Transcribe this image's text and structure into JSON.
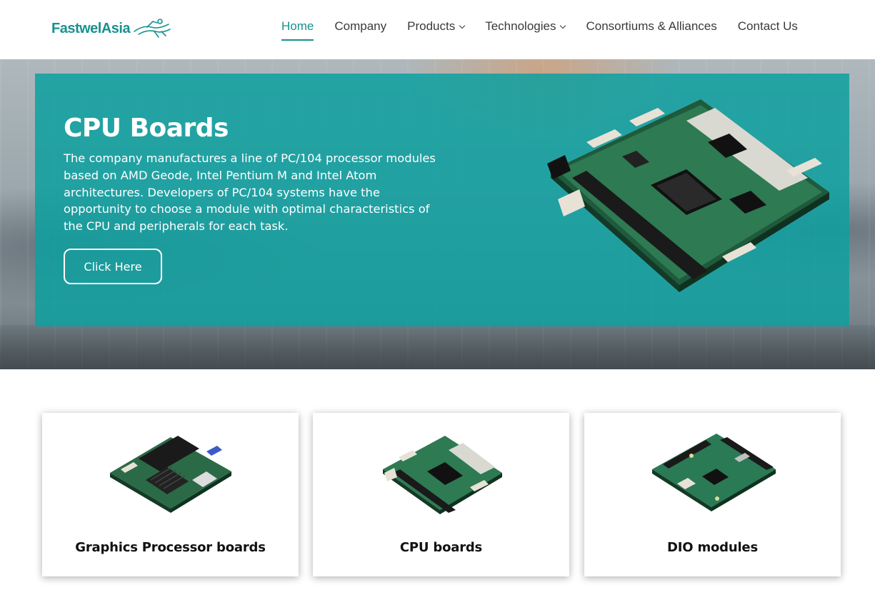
{
  "brand": {
    "name": "FastwelAsia",
    "color": "#17918f",
    "logo_icon": "flying-figure-logo"
  },
  "nav": {
    "items": [
      {
        "label": "Home",
        "active": true,
        "dropdown": false
      },
      {
        "label": "Company",
        "active": false,
        "dropdown": false
      },
      {
        "label": "Products",
        "active": false,
        "dropdown": true
      },
      {
        "label": "Technologies",
        "active": false,
        "dropdown": true
      },
      {
        "label": "Consortiums & Alliances",
        "active": false,
        "dropdown": false
      },
      {
        "label": "Contact Us",
        "active": false,
        "dropdown": false
      }
    ]
  },
  "hero": {
    "title": "CPU Boards",
    "text": "The company manufactures a line of PC/104 processor modules based on AMD Geode, Intel Pentium M and Intel Atom architectures. Developers of PC/104 systems have the opportunity to choose a module with optimal characteristics of the CPU and peripherals for each task.",
    "button_label": "Click Here",
    "overlay_color": "#0ea0a0"
  },
  "cards": [
    {
      "label": "Graphics Processor boards",
      "icon": "graphics-board-image"
    },
    {
      "label": "CPU boards",
      "icon": "cpu-board-image"
    },
    {
      "label": "DIO modules",
      "icon": "dio-board-image"
    }
  ]
}
